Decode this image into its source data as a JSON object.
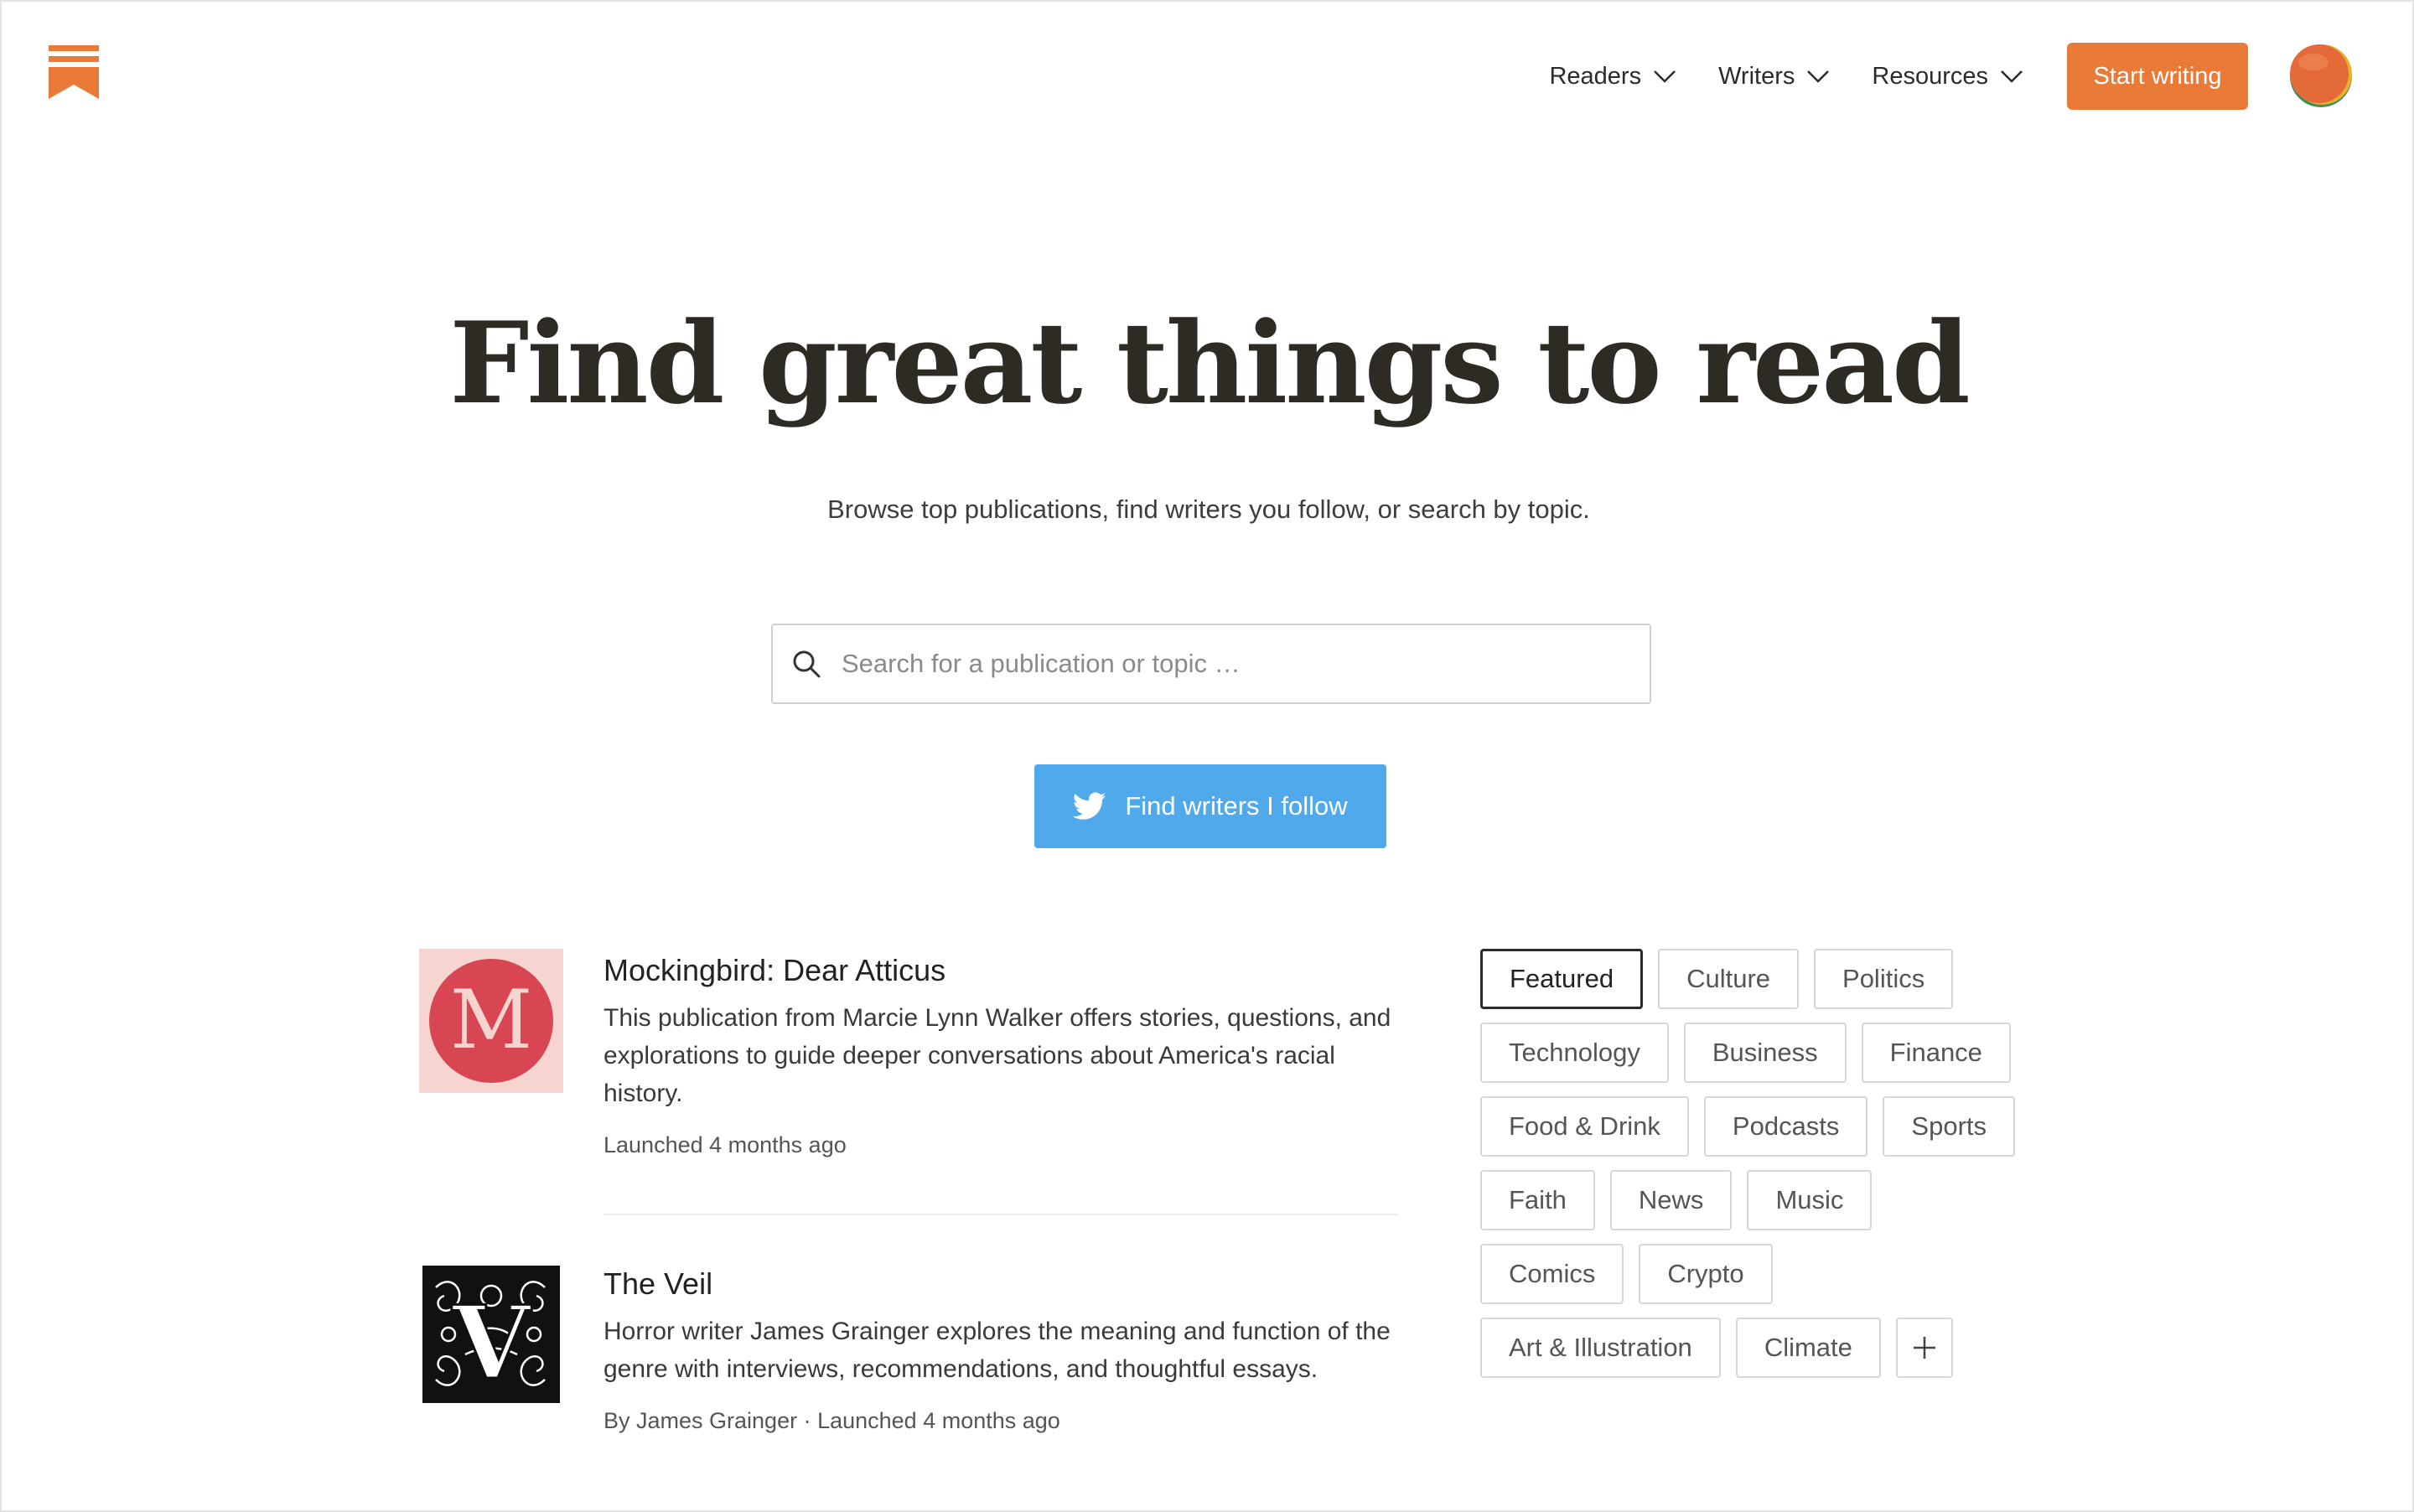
{
  "header": {
    "logo_icon": "substack-bookmark-icon",
    "nav": [
      {
        "label": "Readers",
        "icon": "chevron-down-icon"
      },
      {
        "label": "Writers",
        "icon": "chevron-down-icon"
      },
      {
        "label": "Resources",
        "icon": "chevron-down-icon"
      }
    ],
    "start_writing": "Start writing",
    "avatar_icon": "user-avatar"
  },
  "hero": {
    "title": "Find great things to read",
    "subtitle": "Browse top publications, find writers you follow, or search by topic."
  },
  "search": {
    "placeholder": "Search for a publication or topic …",
    "value": ""
  },
  "twitter_button": {
    "label": "Find writers I follow",
    "icon": "twitter-bird-icon"
  },
  "publications": [
    {
      "title": "Mockingbird: Dear Atticus",
      "description": "This publication from Marcie Lynn Walker offers stories, questions, and explorations to guide deeper conversations about America's racial history.",
      "meta": "Launched 4 months ago",
      "thumb_letter": "M"
    },
    {
      "title": "The Veil",
      "description": "Horror writer James Grainger explores the meaning and function of the genre with interviews, recommendations, and thoughtful essays.",
      "meta": "By James Grainger · Launched 4 months ago",
      "thumb_letter": "V"
    }
  ],
  "topics": {
    "selected": "Featured",
    "items": [
      "Featured",
      "Culture",
      "Politics",
      "Technology",
      "Business",
      "Finance",
      "Food & Drink",
      "Podcasts",
      "Sports",
      "Faith",
      "News",
      "Music",
      "Comics",
      "Crypto",
      "Art & Illustration",
      "Climate"
    ],
    "more_icon": "plus-icon"
  },
  "colors": {
    "brand": "#ea7a37",
    "twitter": "#4fa9ea",
    "mockingbird_bg": "#f6d5d0",
    "mockingbird_circle": "#d94653"
  }
}
